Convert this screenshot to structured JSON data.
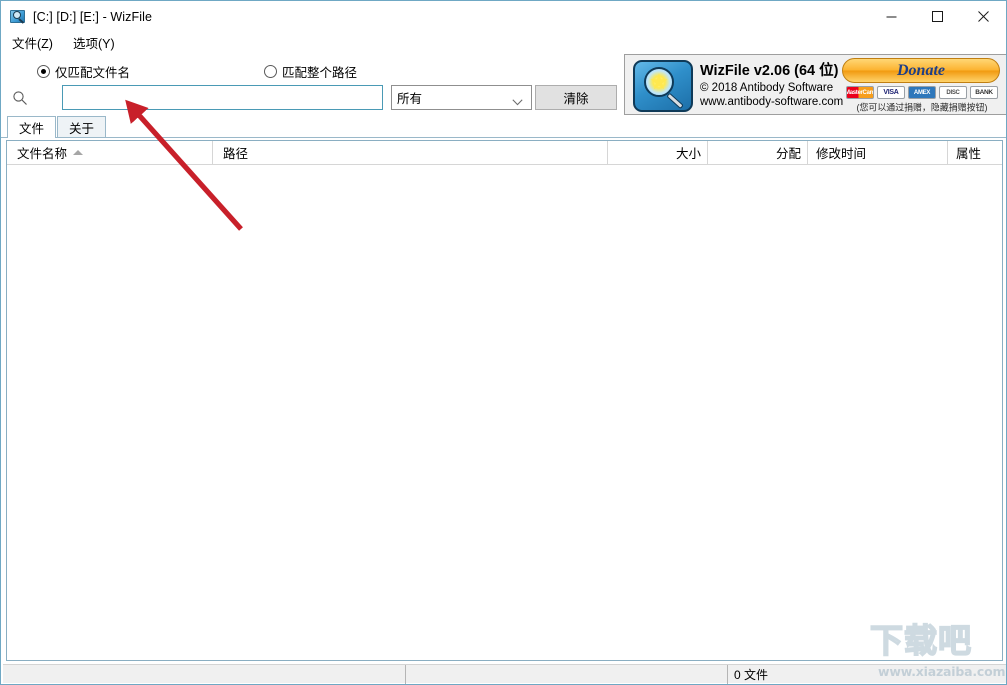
{
  "window": {
    "title": "[C:] [D:] [E:]  - WizFile",
    "icon": "wizfile-app-icon",
    "controls": {
      "minimize": "─",
      "maximize": "□",
      "close": "✕"
    }
  },
  "menu": {
    "items": [
      {
        "label": "文件(Z)",
        "name": "menu-file"
      },
      {
        "label": "选项(Y)",
        "name": "menu-options"
      }
    ]
  },
  "search": {
    "match_options": [
      {
        "label": "仅匹配文件名",
        "selected": true
      },
      {
        "label": "匹配整个路径",
        "selected": false
      }
    ],
    "query": "",
    "placeholder": "",
    "filter_selected": "所有",
    "filter_options": [
      "所有"
    ],
    "clear_label": "清除",
    "search_icon": "search-icon"
  },
  "brand": {
    "title": "WizFile v2.06 (64 位)",
    "copyright": "© 2018 Antibody Software",
    "website": "www.antibody-software.com",
    "donate_label": "Donate",
    "donate_note": "(您可以通过捐赠，隐藏捐赠按钮)",
    "payment_cards": [
      "MasterCard",
      "VISA",
      "AMEX",
      "DISC",
      "BANK"
    ]
  },
  "tabs": [
    {
      "label": "文件",
      "active": true
    },
    {
      "label": "关于",
      "active": false
    }
  ],
  "file_list": {
    "columns": [
      {
        "label": "文件名称",
        "sorted": "asc"
      },
      {
        "label": "路径",
        "sorted": ""
      },
      {
        "label": "大小",
        "sorted": ""
      },
      {
        "label": "分配",
        "sorted": ""
      },
      {
        "label": "修改时间",
        "sorted": ""
      },
      {
        "label": "属性",
        "sorted": ""
      }
    ],
    "rows": []
  },
  "statusbar": {
    "left": "",
    "middle": "",
    "right": "0 文件"
  },
  "watermark": {
    "logo_text": "下载吧",
    "url": "www.xiazaiba.com"
  },
  "annotation": {
    "arrow_color": "#c8202a",
    "description": "red-arrow-pointing-to-search-input"
  }
}
